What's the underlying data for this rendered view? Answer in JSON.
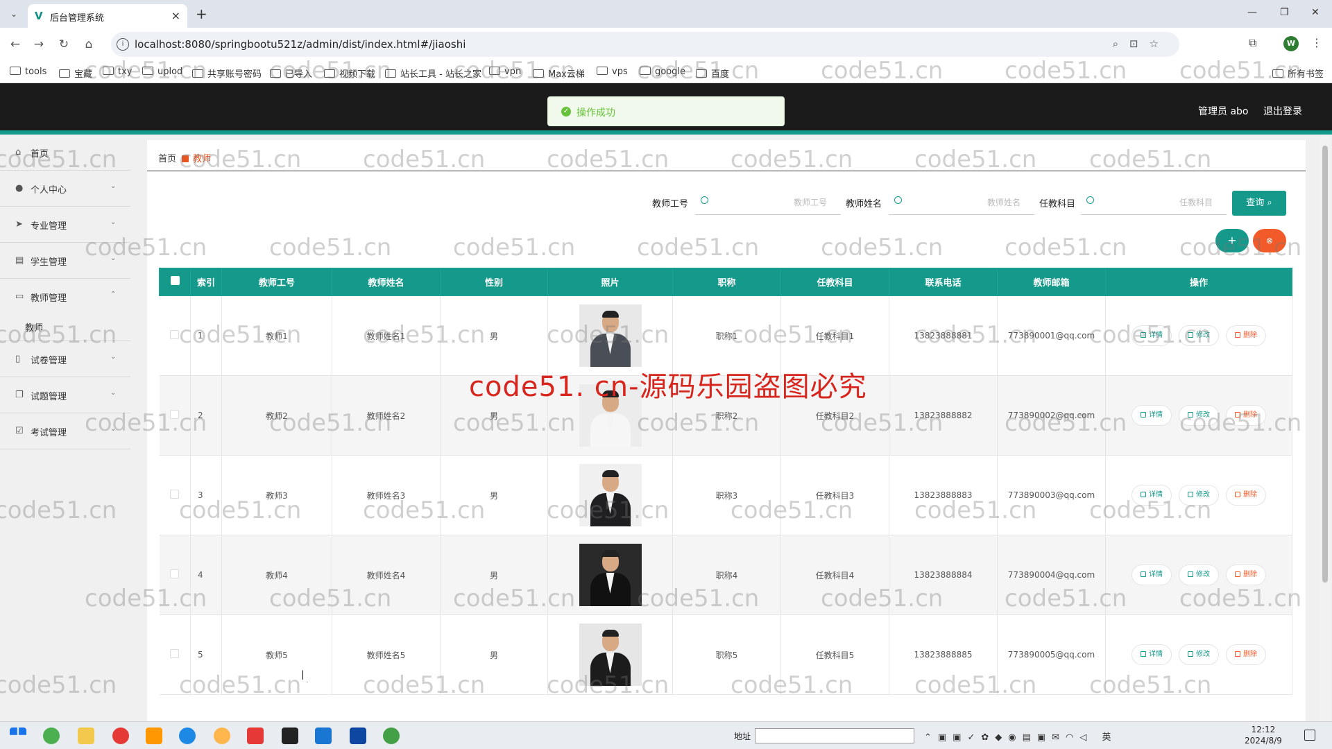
{
  "browser": {
    "tab_title": "后台管理系统",
    "url": "localhost:8080/springbootu521z/admin/dist/index.html#/jiaoshi",
    "profile_initial": "W",
    "bookmarks": [
      "tools",
      "宝藏",
      "txy",
      "uplod",
      "共享账号密码",
      "已导入",
      "视频下载",
      "站长工具 - 站长之家",
      "vpn",
      "Max云梯",
      "vps",
      "google",
      "百度"
    ],
    "all_bookmarks": "所有书签"
  },
  "header": {
    "user_label": "管理员 abo",
    "logout_label": "退出登录",
    "toast_message": "操作成功"
  },
  "sidebar": {
    "items": [
      {
        "label": "首页",
        "icon": "home-icon"
      },
      {
        "label": "个人中心",
        "icon": "user-icon"
      },
      {
        "label": "专业管理",
        "icon": "send-icon"
      },
      {
        "label": "学生管理",
        "icon": "clipboard-icon"
      },
      {
        "label": "教师管理",
        "icon": "chat-icon"
      },
      {
        "label": "试卷管理",
        "icon": "phone-icon"
      },
      {
        "label": "试题管理",
        "icon": "copy-icon"
      },
      {
        "label": "考试管理",
        "icon": "checkbox-icon"
      }
    ],
    "submenu_label": "教师"
  },
  "breadcrumb": {
    "home": "首页",
    "current": "教师"
  },
  "search": {
    "fields": [
      {
        "label": "教师工号",
        "placeholder": "教师工号"
      },
      {
        "label": "教师姓名",
        "placeholder": "教师姓名"
      },
      {
        "label": "任教科目",
        "placeholder": "任教科目"
      }
    ],
    "query_label": "查询"
  },
  "actions": {
    "add_label": "+",
    "delete_label": "⊗"
  },
  "table": {
    "columns": [
      "索引",
      "教师工号",
      "教师姓名",
      "性别",
      "照片",
      "职称",
      "任教科目",
      "联系电话",
      "教师邮箱",
      "操作"
    ],
    "row_actions": {
      "detail": "详情",
      "edit": "修改",
      "delete": "删除"
    },
    "rows": [
      {
        "index": "1",
        "id": "教师1",
        "name": "教师姓名1",
        "gender": "男",
        "title": "职称1",
        "subject": "任教科目1",
        "phone": "13823888881",
        "email": "773890001@qq.com"
      },
      {
        "index": "2",
        "id": "教师2",
        "name": "教师姓名2",
        "gender": "男",
        "title": "职称2",
        "subject": "任教科目2",
        "phone": "13823888882",
        "email": "773890002@qq.com"
      },
      {
        "index": "3",
        "id": "教师3",
        "name": "教师姓名3",
        "gender": "男",
        "title": "职称3",
        "subject": "任教科目3",
        "phone": "13823888883",
        "email": "773890003@qq.com"
      },
      {
        "index": "4",
        "id": "教师4",
        "name": "教师姓名4",
        "gender": "男",
        "title": "职称4",
        "subject": "任教科目4",
        "phone": "13823888884",
        "email": "773890004@qq.com"
      },
      {
        "index": "5",
        "id": "教师5",
        "name": "教师姓名5",
        "gender": "男",
        "title": "职称5",
        "subject": "任教科目5",
        "phone": "13823888885",
        "email": "773890005@qq.com"
      }
    ]
  },
  "watermark": {
    "small": "code51.cn",
    "big": "code51. cn-源码乐园盗图必究"
  },
  "taskbar": {
    "address_label": "地址",
    "time": "12:12",
    "date": "2024/8/9",
    "ime": "英"
  },
  "colors": {
    "primary": "#14998b",
    "danger": "#f25a29",
    "header": "#1b1b1b",
    "success": "#67c23a"
  }
}
